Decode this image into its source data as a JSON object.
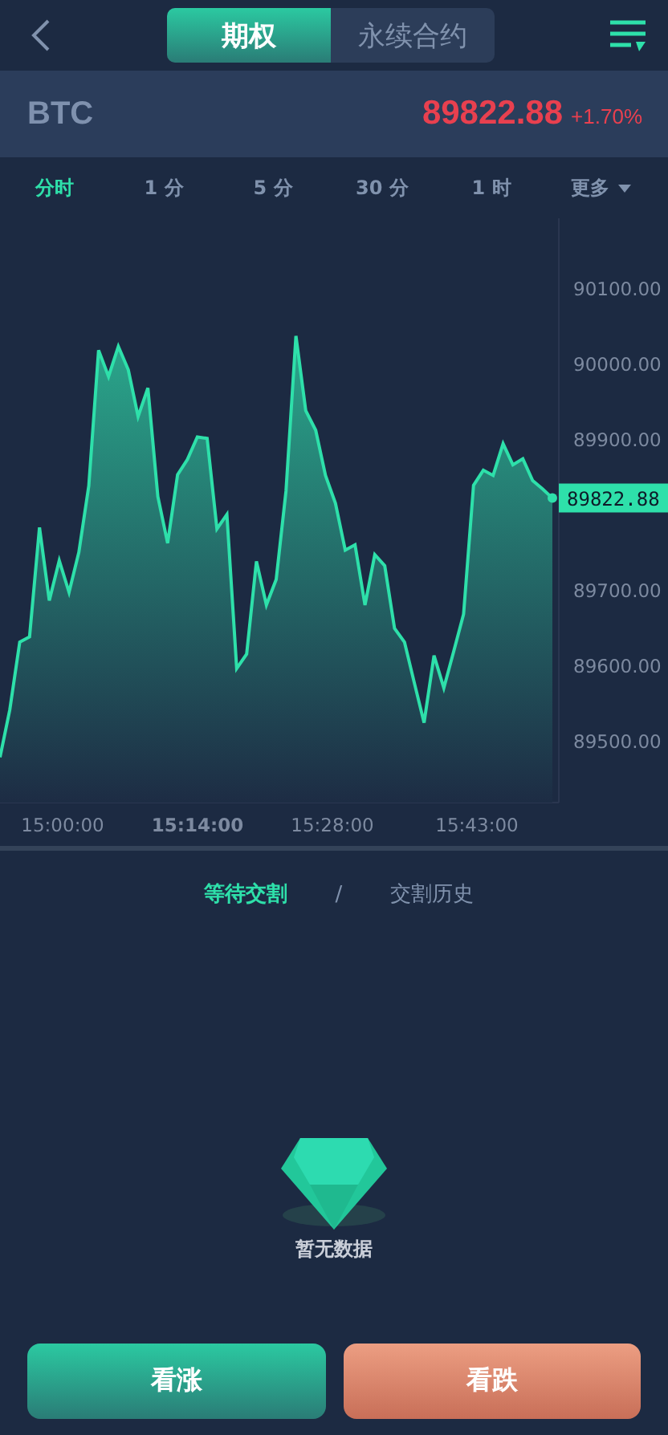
{
  "header": {
    "tabs": [
      {
        "label": "期权",
        "selected": true
      },
      {
        "label": "永续合约",
        "selected": false
      }
    ]
  },
  "ticker": {
    "symbol": "BTC",
    "price": "89822.88",
    "change": "+1.70%"
  },
  "periods": [
    {
      "label": "分时",
      "selected": true
    },
    {
      "label": "1 分",
      "selected": false
    },
    {
      "label": "5 分",
      "selected": false
    },
    {
      "label": "30 分",
      "selected": false
    },
    {
      "label": "1 时",
      "selected": false
    },
    {
      "label": "更多",
      "selected": false,
      "dropdown": true
    }
  ],
  "chart_data": {
    "type": "area",
    "series": [
      {
        "color": "#2ee0aa",
        "values": [
          89479,
          89542,
          89632,
          89639,
          89784,
          89687,
          89740,
          89698,
          89751,
          89839,
          90019,
          89984,
          90024,
          89993,
          89931,
          89969,
          89825,
          89763,
          89854,
          89874,
          89904,
          89902,
          89782,
          89801,
          89597,
          89616,
          89739,
          89681,
          89715,
          89832,
          90038,
          89939,
          89913,
          89853,
          89816,
          89754,
          89761,
          89681,
          89748,
          89733,
          89650,
          89632,
          89578,
          89525,
          89614,
          89571,
          89620,
          89669,
          89840,
          89860,
          89853,
          89895,
          89867,
          89875,
          89846,
          89835,
          89823
        ]
      }
    ],
    "ylim": [
      89419,
      90194
    ],
    "yticks": [
      {
        "value": 89500,
        "label": "89500.00"
      },
      {
        "value": 89600,
        "label": "89600.00"
      },
      {
        "value": 89700,
        "label": "89700.00"
      },
      {
        "value": 89900,
        "label": "89900.00"
      },
      {
        "value": 90000,
        "label": "90000.00"
      },
      {
        "value": 90100,
        "label": "90100.00"
      }
    ]
  },
  "time_labels": [
    "15:00:00",
    "15:14:00",
    "15:28:00",
    "15:43:00"
  ],
  "price_tag": "89822.88",
  "orders": {
    "tabs": [
      {
        "label": "等待交割",
        "selected": true
      },
      {
        "label": "交割历史",
        "selected": false
      }
    ],
    "separator": "/",
    "empty": "暂无数据"
  },
  "actions": [
    {
      "label": "看涨",
      "kind": "up"
    },
    {
      "label": "看跌",
      "kind": "down"
    }
  ]
}
